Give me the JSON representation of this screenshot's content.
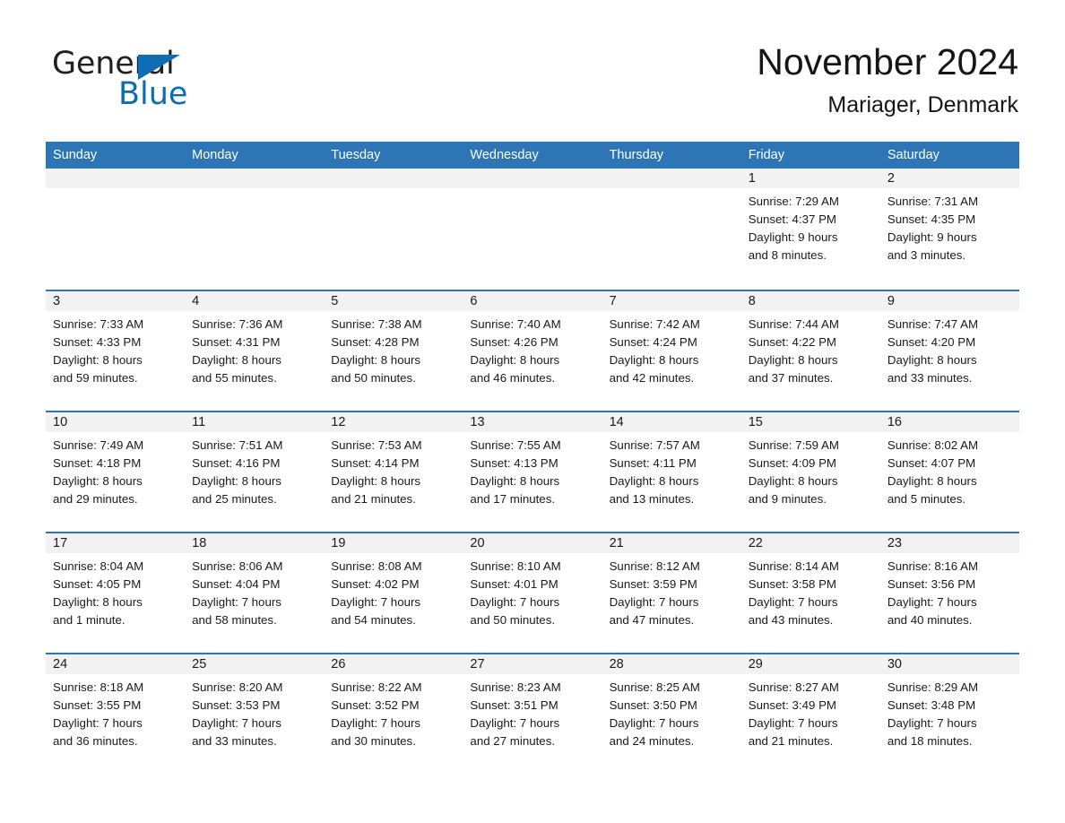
{
  "brand": {
    "name_part1": "General",
    "name_part2": "Blue",
    "triangle_icon": "triangle-icon",
    "accent_color": "#0d6cb6"
  },
  "header": {
    "title": "November 2024",
    "subtitle": "Mariager, Denmark"
  },
  "colors": {
    "header_blue": "#2e75b6",
    "day_band_gray": "#f2f2f2",
    "text": "#1a1a1a",
    "page_background": "#ffffff"
  },
  "weekdays": [
    "Sunday",
    "Monday",
    "Tuesday",
    "Wednesday",
    "Thursday",
    "Friday",
    "Saturday"
  ],
  "weeks": [
    [
      {
        "day": "",
        "empty": true,
        "lines": []
      },
      {
        "day": "",
        "empty": true,
        "lines": []
      },
      {
        "day": "",
        "empty": true,
        "lines": []
      },
      {
        "day": "",
        "empty": true,
        "lines": []
      },
      {
        "day": "",
        "empty": true,
        "lines": []
      },
      {
        "day": "1",
        "empty": false,
        "lines": [
          "Sunrise: 7:29 AM",
          "Sunset: 4:37 PM",
          "Daylight: 9 hours",
          "and 8 minutes."
        ]
      },
      {
        "day": "2",
        "empty": false,
        "lines": [
          "Sunrise: 7:31 AM",
          "Sunset: 4:35 PM",
          "Daylight: 9 hours",
          "and 3 minutes."
        ]
      }
    ],
    [
      {
        "day": "3",
        "empty": false,
        "lines": [
          "Sunrise: 7:33 AM",
          "Sunset: 4:33 PM",
          "Daylight: 8 hours",
          "and 59 minutes."
        ]
      },
      {
        "day": "4",
        "empty": false,
        "lines": [
          "Sunrise: 7:36 AM",
          "Sunset: 4:31 PM",
          "Daylight: 8 hours",
          "and 55 minutes."
        ]
      },
      {
        "day": "5",
        "empty": false,
        "lines": [
          "Sunrise: 7:38 AM",
          "Sunset: 4:28 PM",
          "Daylight: 8 hours",
          "and 50 minutes."
        ]
      },
      {
        "day": "6",
        "empty": false,
        "lines": [
          "Sunrise: 7:40 AM",
          "Sunset: 4:26 PM",
          "Daylight: 8 hours",
          "and 46 minutes."
        ]
      },
      {
        "day": "7",
        "empty": false,
        "lines": [
          "Sunrise: 7:42 AM",
          "Sunset: 4:24 PM",
          "Daylight: 8 hours",
          "and 42 minutes."
        ]
      },
      {
        "day": "8",
        "empty": false,
        "lines": [
          "Sunrise: 7:44 AM",
          "Sunset: 4:22 PM",
          "Daylight: 8 hours",
          "and 37 minutes."
        ]
      },
      {
        "day": "9",
        "empty": false,
        "lines": [
          "Sunrise: 7:47 AM",
          "Sunset: 4:20 PM",
          "Daylight: 8 hours",
          "and 33 minutes."
        ]
      }
    ],
    [
      {
        "day": "10",
        "empty": false,
        "lines": [
          "Sunrise: 7:49 AM",
          "Sunset: 4:18 PM",
          "Daylight: 8 hours",
          "and 29 minutes."
        ]
      },
      {
        "day": "11",
        "empty": false,
        "lines": [
          "Sunrise: 7:51 AM",
          "Sunset: 4:16 PM",
          "Daylight: 8 hours",
          "and 25 minutes."
        ]
      },
      {
        "day": "12",
        "empty": false,
        "lines": [
          "Sunrise: 7:53 AM",
          "Sunset: 4:14 PM",
          "Daylight: 8 hours",
          "and 21 minutes."
        ]
      },
      {
        "day": "13",
        "empty": false,
        "lines": [
          "Sunrise: 7:55 AM",
          "Sunset: 4:13 PM",
          "Daylight: 8 hours",
          "and 17 minutes."
        ]
      },
      {
        "day": "14",
        "empty": false,
        "lines": [
          "Sunrise: 7:57 AM",
          "Sunset: 4:11 PM",
          "Daylight: 8 hours",
          "and 13 minutes."
        ]
      },
      {
        "day": "15",
        "empty": false,
        "lines": [
          "Sunrise: 7:59 AM",
          "Sunset: 4:09 PM",
          "Daylight: 8 hours",
          "and 9 minutes."
        ]
      },
      {
        "day": "16",
        "empty": false,
        "lines": [
          "Sunrise: 8:02 AM",
          "Sunset: 4:07 PM",
          "Daylight: 8 hours",
          "and 5 minutes."
        ]
      }
    ],
    [
      {
        "day": "17",
        "empty": false,
        "lines": [
          "Sunrise: 8:04 AM",
          "Sunset: 4:05 PM",
          "Daylight: 8 hours",
          "and 1 minute."
        ]
      },
      {
        "day": "18",
        "empty": false,
        "lines": [
          "Sunrise: 8:06 AM",
          "Sunset: 4:04 PM",
          "Daylight: 7 hours",
          "and 58 minutes."
        ]
      },
      {
        "day": "19",
        "empty": false,
        "lines": [
          "Sunrise: 8:08 AM",
          "Sunset: 4:02 PM",
          "Daylight: 7 hours",
          "and 54 minutes."
        ]
      },
      {
        "day": "20",
        "empty": false,
        "lines": [
          "Sunrise: 8:10 AM",
          "Sunset: 4:01 PM",
          "Daylight: 7 hours",
          "and 50 minutes."
        ]
      },
      {
        "day": "21",
        "empty": false,
        "lines": [
          "Sunrise: 8:12 AM",
          "Sunset: 3:59 PM",
          "Daylight: 7 hours",
          "and 47 minutes."
        ]
      },
      {
        "day": "22",
        "empty": false,
        "lines": [
          "Sunrise: 8:14 AM",
          "Sunset: 3:58 PM",
          "Daylight: 7 hours",
          "and 43 minutes."
        ]
      },
      {
        "day": "23",
        "empty": false,
        "lines": [
          "Sunrise: 8:16 AM",
          "Sunset: 3:56 PM",
          "Daylight: 7 hours",
          "and 40 minutes."
        ]
      }
    ],
    [
      {
        "day": "24",
        "empty": false,
        "lines": [
          "Sunrise: 8:18 AM",
          "Sunset: 3:55 PM",
          "Daylight: 7 hours",
          "and 36 minutes."
        ]
      },
      {
        "day": "25",
        "empty": false,
        "lines": [
          "Sunrise: 8:20 AM",
          "Sunset: 3:53 PM",
          "Daylight: 7 hours",
          "and 33 minutes."
        ]
      },
      {
        "day": "26",
        "empty": false,
        "lines": [
          "Sunrise: 8:22 AM",
          "Sunset: 3:52 PM",
          "Daylight: 7 hours",
          "and 30 minutes."
        ]
      },
      {
        "day": "27",
        "empty": false,
        "lines": [
          "Sunrise: 8:23 AM",
          "Sunset: 3:51 PM",
          "Daylight: 7 hours",
          "and 27 minutes."
        ]
      },
      {
        "day": "28",
        "empty": false,
        "lines": [
          "Sunrise: 8:25 AM",
          "Sunset: 3:50 PM",
          "Daylight: 7 hours",
          "and 24 minutes."
        ]
      },
      {
        "day": "29",
        "empty": false,
        "lines": [
          "Sunrise: 8:27 AM",
          "Sunset: 3:49 PM",
          "Daylight: 7 hours",
          "and 21 minutes."
        ]
      },
      {
        "day": "30",
        "empty": false,
        "lines": [
          "Sunrise: 8:29 AM",
          "Sunset: 3:48 PM",
          "Daylight: 7 hours",
          "and 18 minutes."
        ]
      }
    ]
  ]
}
